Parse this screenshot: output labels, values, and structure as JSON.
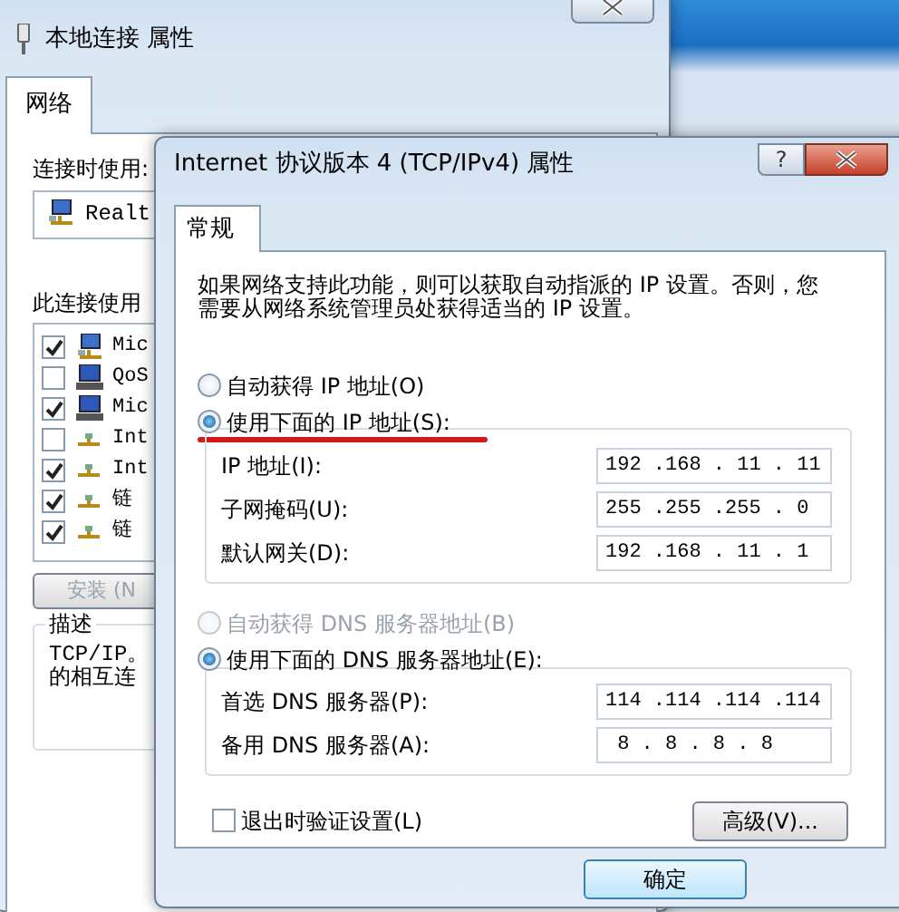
{
  "background_window": {
    "title": "本地连接 属性",
    "tabs": [
      {
        "label": "网络",
        "selected": true
      }
    ],
    "connect_using_label": "连接时使用:",
    "adapter": "Realt",
    "components_label": "此连接使用",
    "components": [
      {
        "label": "Mic",
        "checked": true,
        "kind": "client"
      },
      {
        "label": "QoS",
        "checked": false,
        "kind": "service"
      },
      {
        "label": "Mic",
        "checked": true,
        "kind": "service"
      },
      {
        "label": "Int",
        "checked": false,
        "kind": "protocol"
      },
      {
        "label": "Int",
        "checked": true,
        "kind": "protocol"
      },
      {
        "label": "链",
        "checked": true,
        "kind": "protocol"
      },
      {
        "label": "链",
        "checked": true,
        "kind": "protocol"
      }
    ],
    "install_button": {
      "label": "安装 (N",
      "disabled": true
    },
    "description_label": "描述",
    "description": [
      "TCP/IP。",
      "的相互连"
    ]
  },
  "dialog": {
    "title": "Internet 协议版本 4 (TCP/IPv4) 属性",
    "help_button": "?",
    "tabs": [
      {
        "label": "常规",
        "selected": true
      }
    ],
    "intro": "如果网络支持此功能，则可以获取自动指派的 IP 设置。否则，您需要从网络系统管理员处获得适当的 IP 设置。",
    "ip_mode": [
      {
        "label": "自动获得 IP 地址(O)",
        "selected": false,
        "disabled": false
      },
      {
        "label": "使用下面的 IP 地址(S):",
        "selected": true,
        "disabled": false
      }
    ],
    "ip_fields": [
      {
        "label": "IP 地址(I):",
        "value": "192 .168 . 11 . 11"
      },
      {
        "label": "子网掩码(U):",
        "value": "255 .255 .255 . 0"
      },
      {
        "label": "默认网关(D):",
        "value": "192 .168 . 11 . 1"
      }
    ],
    "dns_mode": [
      {
        "label": "自动获得 DNS 服务器地址(B)",
        "selected": false,
        "disabled": true
      },
      {
        "label": "使用下面的 DNS 服务器地址(E):",
        "selected": true,
        "disabled": false
      }
    ],
    "dns_fields": [
      {
        "label": "首选 DNS 服务器(P):",
        "value": "114 .114 .114 .114"
      },
      {
        "label": "备用 DNS 服务器(A):",
        "value": " 8 . 8 . 8 . 8"
      }
    ],
    "validate_on_exit": {
      "label": "退出时验证设置(L)",
      "checked": false
    },
    "advanced_button": "高级(V)...",
    "ok_button": "确定"
  }
}
